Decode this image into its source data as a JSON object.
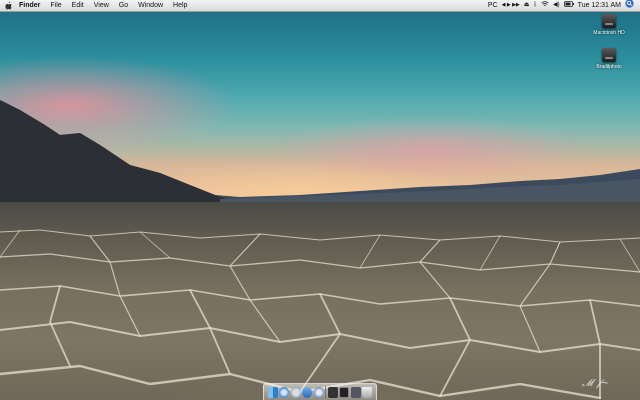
{
  "menubar": {
    "app_name": "Finder",
    "items": [
      "File",
      "Edit",
      "View",
      "Go",
      "Window",
      "Help"
    ],
    "status": {
      "input_source": "PC",
      "media_controls": "◀ ▶ ▶▶",
      "clock": "Tue 12:31 AM",
      "icons": [
        "eject-icon",
        "bluetooth-icon",
        "wifi-icon",
        "volume-icon",
        "battery-icon",
        "spotlight-icon"
      ]
    }
  },
  "desktop_icons": [
    {
      "label": "Macintosh HD",
      "icon": "hard-drive-icon"
    },
    {
      "label": "Bradilphoto",
      "icon": "external-drive-icon"
    }
  ],
  "dock": {
    "items": [
      "finder-icon",
      "safari-icon",
      "mail-icon",
      "ichat-icon",
      "itunes-icon",
      "photos-icon",
      "terminal-icon",
      "application-icon",
      "trash-icon"
    ]
  },
  "wallpaper": {
    "description_colors": {
      "sky_top": "#1e6f86",
      "horizon": "#f2c79d",
      "ground": "#77705f"
    }
  }
}
